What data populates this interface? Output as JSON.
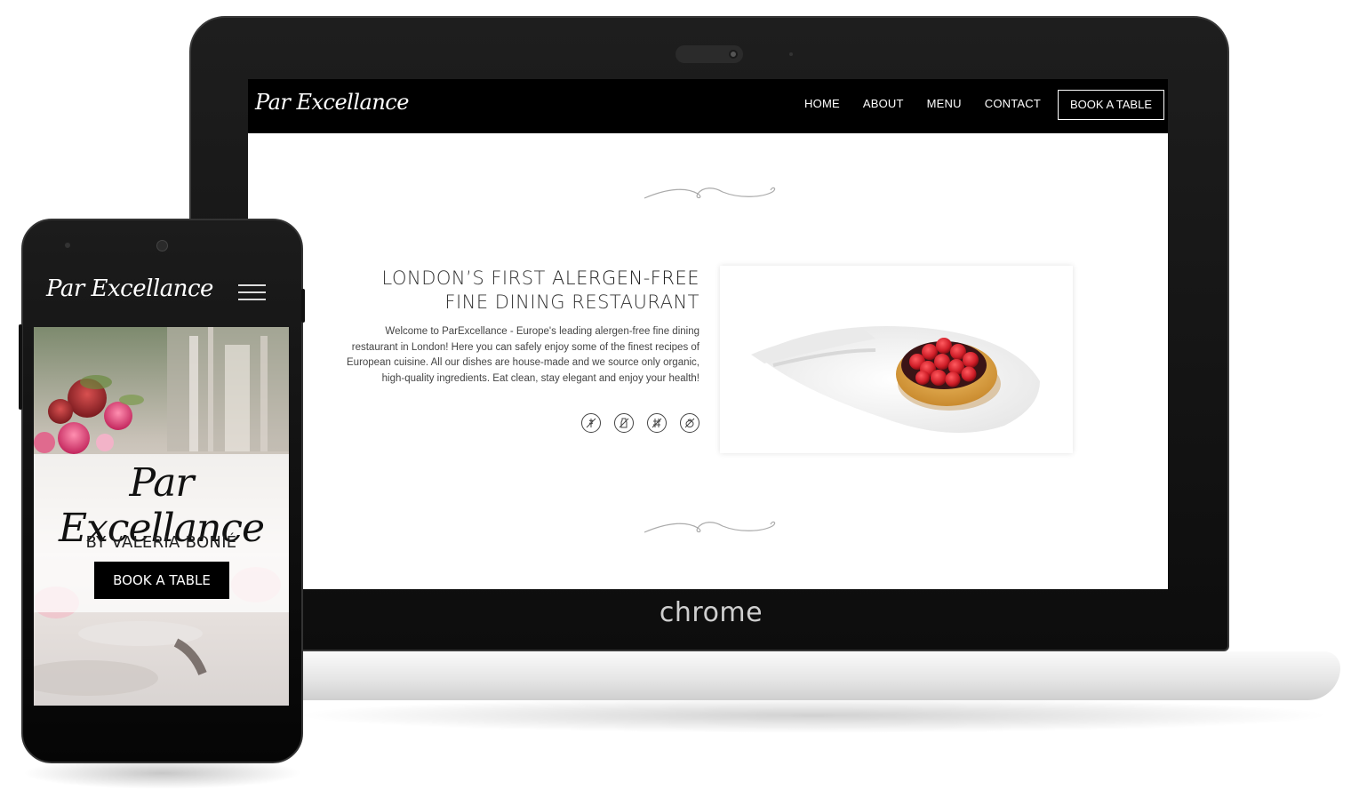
{
  "laptop": {
    "brand": "chrome",
    "site": {
      "logo": "Par Excellance",
      "nav": {
        "items": [
          "HOME",
          "ABOUT",
          "MENU",
          "CONTACT"
        ],
        "book_button": "BOOK A TABLE"
      },
      "hero": {
        "heading_part1": "LONDON’S FIRST ",
        "heading_highlight": "ALERGEN-FREE",
        "heading_line2": "FINE DINING RESTAURANT",
        "body": "Welcome to ParExcellance - Europe's leading alergen-free fine dining restaurant in London! Here you can safely enjoy some of the finest recipes of European cuisine. All our dishes are house-made and we source only organic, high-quality ingredients. Eat clean, stay elegant and enjoy your health!",
        "allergen_icons": [
          "no-gluten-icon",
          "no-dairy-icon",
          "no-wheat-icon",
          "no-nuts-icon"
        ]
      },
      "image": "raspberry-tart"
    }
  },
  "phone": {
    "logo": "Par Excellance",
    "menu_icon": "hamburger-icon",
    "hero_title": "Par Excellance",
    "byline": "BY VALERIA BONIÉ",
    "book_button": "BOOK A TABLE"
  },
  "colors": {
    "nav_bg": "#000000",
    "text_dark": "#333333",
    "tart_red": "#d42a2f"
  }
}
